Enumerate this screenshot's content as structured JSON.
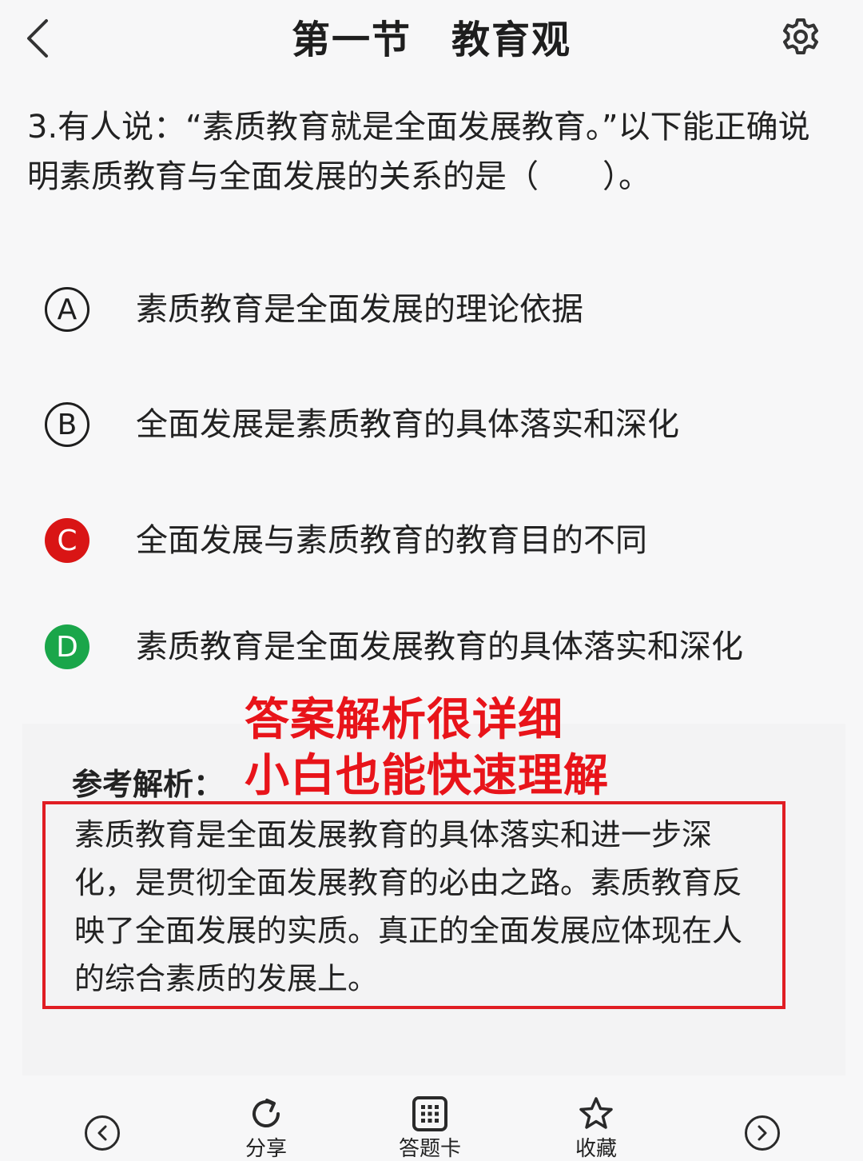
{
  "header": {
    "title": "第一节　教育观",
    "back_icon": "chevron-left-icon",
    "settings_icon": "gear-icon"
  },
  "question": {
    "text": "3.有人说：“素质教育就是全面发展教育。”以下能正确说明素质教育与全面发展的关系的是（　　）。"
  },
  "options": [
    {
      "letter": "A",
      "text": "素质教育是全面发展的理论依据",
      "state": "normal"
    },
    {
      "letter": "B",
      "text": "全面发展是素质教育的具体落实和深化",
      "state": "normal"
    },
    {
      "letter": "C",
      "text": "全面发展与素质教育的教育目的不同",
      "state": "wrong"
    },
    {
      "letter": "D",
      "text": "素质教育是全面发展教育的具体落实和深化",
      "state": "correct"
    }
  ],
  "overlay": {
    "line1": "答案解析很详细",
    "line2": "小白也能快速理解",
    "color": "#e8141a"
  },
  "analysis": {
    "label": "参考解析：",
    "text": "素质教育是全面发展教育的具体落实和进一步深化，是贯彻全面发展教育的必由之路。素质教育反映了全面发展的实质。真正的全面发展应体现在人的综合素质的发展上。"
  },
  "toolbar": {
    "share_label": "分享",
    "card_label": "答题卡",
    "favorite_label": "收藏"
  },
  "colors": {
    "wrong": "#d91515",
    "correct": "#1aa64a",
    "highlight_border": "#e01d23"
  }
}
